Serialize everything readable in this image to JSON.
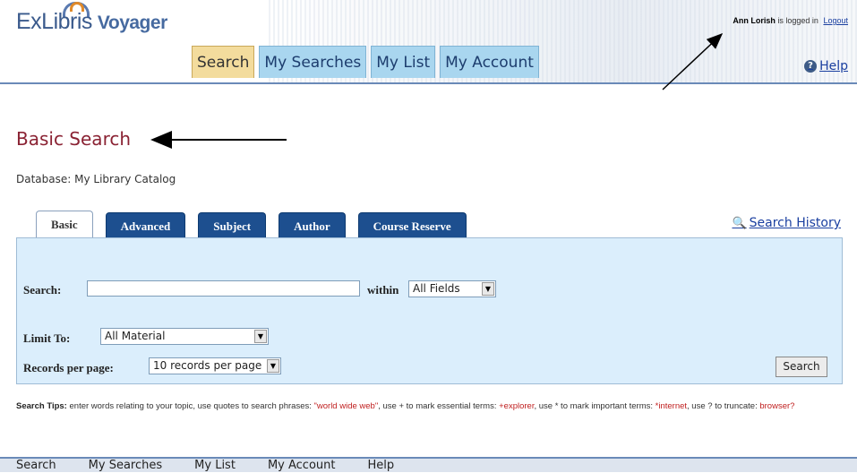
{
  "header": {
    "logo_brand": "ExLibris",
    "logo_product": "Voyager",
    "tabs": [
      {
        "label": "Search",
        "active": true
      },
      {
        "label": "My Searches",
        "active": false
      },
      {
        "label": "My List",
        "active": false
      },
      {
        "label": "My Account",
        "active": false
      }
    ],
    "login": {
      "user": "Ann Lorish",
      "status": "is logged in",
      "logout": "Logout"
    },
    "help": "Help"
  },
  "main": {
    "title": "Basic Search",
    "database": "Database: My Library Catalog",
    "search_tabs": [
      {
        "label": "Basic",
        "active": true
      },
      {
        "label": "Advanced",
        "active": false
      },
      {
        "label": "Subject",
        "active": false
      },
      {
        "label": "Author",
        "active": false
      },
      {
        "label": "Course Reserve",
        "active": false
      }
    ],
    "search_history": "Search History",
    "form": {
      "search_label": "Search:",
      "search_value": "",
      "within_label": "within",
      "within_value": "All Fields",
      "limit_label": "Limit To:",
      "limit_value": "All Material",
      "records_label": "Records per page:",
      "records_value": "10 records per page",
      "search_button": "Search"
    },
    "tips": {
      "label": "Search Tips:",
      "t1": " enter words relating to your topic, use quotes to search phrases: ",
      "e1": "\"world wide web\"",
      "t2": ", use + to mark essential terms: ",
      "e2": "+explorer",
      "t3": ", use * to mark important terms: ",
      "e3": "*internet",
      "t4": ", use ? to truncate: ",
      "e4": "browser?"
    }
  },
  "footer": {
    "items": [
      "Search",
      "My Searches",
      "My List",
      "My Account",
      "Help"
    ]
  },
  "colors": {
    "title": "#8a2233",
    "tab_blue": "#1d4f8f",
    "panel": "#dbeefc",
    "active_top_tab": "#f3dc9d",
    "top_tab": "#a9d6ef"
  }
}
